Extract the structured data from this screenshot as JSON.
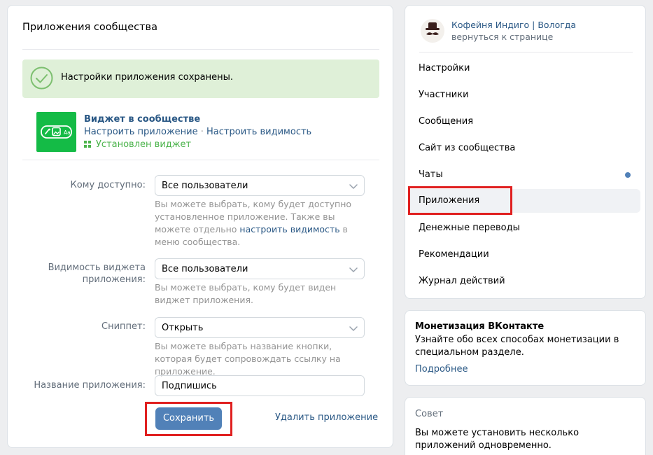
{
  "main": {
    "title": "Приложения сообщества",
    "notice": "Настройки приложения сохранены.",
    "app": {
      "name": "Виджет в сообществе",
      "configure_link": "Настроить приложение",
      "separator": "·",
      "visibility_link": "Настроить видимость",
      "status": "Установлен виджет"
    },
    "fields": {
      "access": {
        "label": "Кому доступно:",
        "value": "Все пользователи",
        "hint_part1": "Вы можете выбрать, кому будет доступно установленное приложение. Также вы можете отдельно ",
        "hint_link": "настроить видимость",
        "hint_part2": " в меню сообщества."
      },
      "widget_visibility": {
        "label_line1": "Видимость виджета",
        "label_line2": "приложения:",
        "value": "Все пользователи",
        "hint": "Вы можете выбрать, кому будет виден виджет приложения."
      },
      "snippet": {
        "label": "Сниппет:",
        "value": "Открыть",
        "hint": "Вы можете выбрать название кнопки, которая будет сопровождать ссылку на приложение."
      },
      "app_name": {
        "label": "Название приложения:",
        "value": "Подпишись"
      }
    },
    "save_button": "Сохранить",
    "delete_link": "Удалить приложение"
  },
  "sidebar": {
    "community_name": "Кофейня Индиго | Вологда",
    "back_link": "вернуться к странице",
    "items": [
      {
        "label": "Настройки"
      },
      {
        "label": "Участники"
      },
      {
        "label": "Сообщения"
      },
      {
        "label": "Сайт из сообщества"
      },
      {
        "label": "Чаты",
        "badge": "dot"
      },
      {
        "label": "Приложения",
        "active": true
      },
      {
        "label": "Денежные переводы"
      },
      {
        "label": "Рекомендации"
      },
      {
        "label": "Журнал действий"
      }
    ]
  },
  "monetization": {
    "title": "Монетизация ВКонтакте",
    "text": "Узнайте обо всех способах монетизации в специальном разделе.",
    "link": "Подробнее"
  },
  "tip": {
    "title": "Совет",
    "text": "Вы можете установить несколько приложений одновременно."
  },
  "colors": {
    "accent": "#5181b8",
    "link": "#2a5885",
    "success_bg": "#dff0d8",
    "success": "#4bb34b",
    "app_icon_bg": "#14bb46",
    "highlight": "#e02020"
  }
}
